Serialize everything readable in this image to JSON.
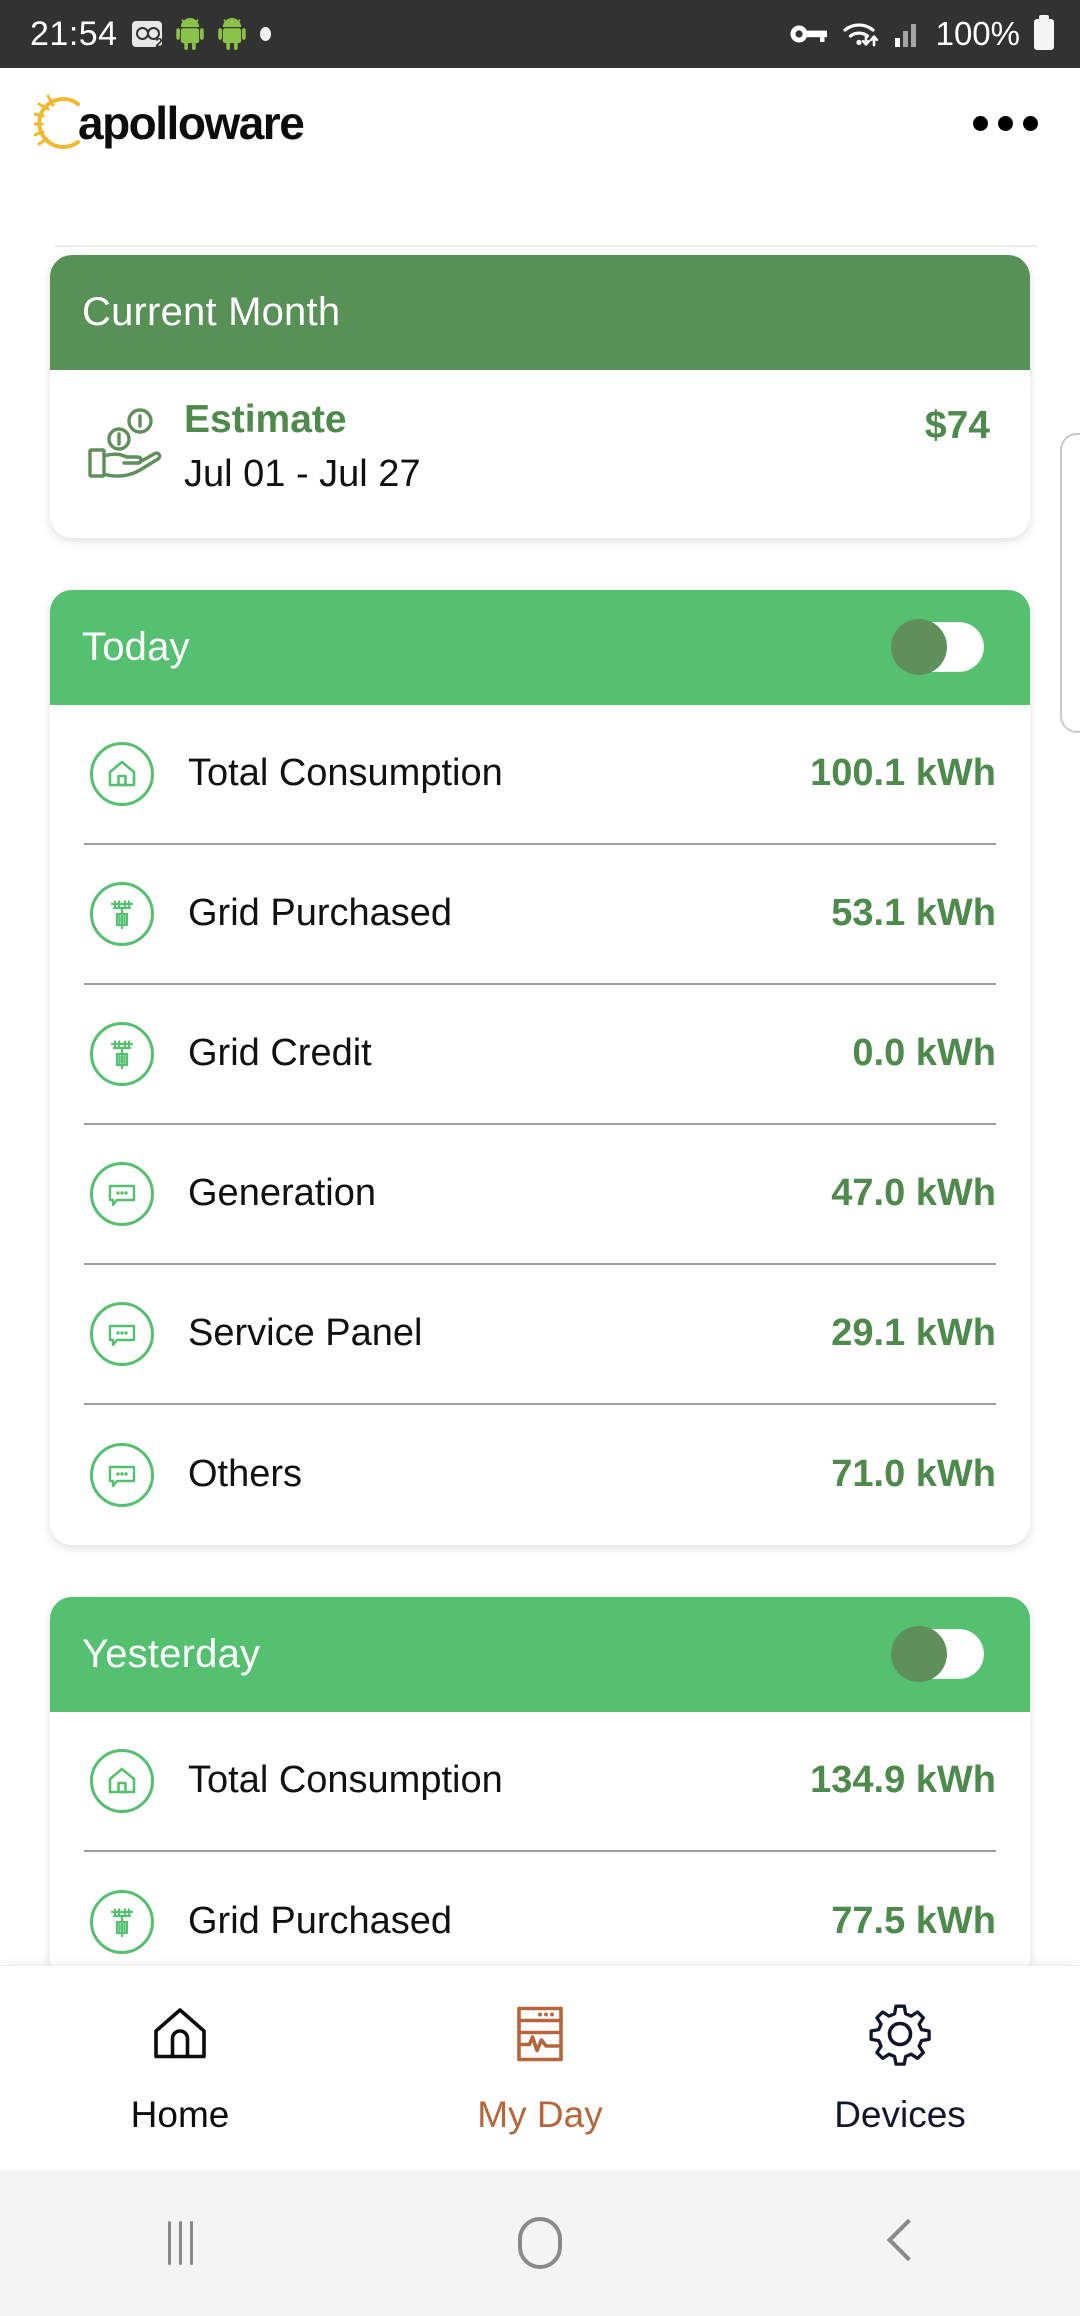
{
  "status_bar": {
    "time": "21:54",
    "voicemail_badge": "2",
    "battery_percent": "100%",
    "icons": [
      "voicemail-icon",
      "android-robot-icon",
      "android-robot-icon",
      "dot-icon",
      "vpn-key-icon",
      "wifi-icon",
      "cellular-signal-icon",
      "battery-icon"
    ]
  },
  "header": {
    "logo_text": "apolloware",
    "overflow_label": "overflow-menu"
  },
  "current_month": {
    "title": "Current Month",
    "estimate_label": "Estimate",
    "date_range": "Jul 01 - Jul 27",
    "amount": "$74",
    "icon": "hand-coins-icon"
  },
  "today": {
    "title": "Today",
    "toggle_on": false,
    "rows": [
      {
        "icon": "home-icon",
        "label": "Total Consumption",
        "value": "100.1 kWh"
      },
      {
        "icon": "utility-pole-icon",
        "label": "Grid Purchased",
        "value": "53.1 kWh"
      },
      {
        "icon": "utility-pole-icon",
        "label": "Grid Credit",
        "value": "0.0 kWh"
      },
      {
        "icon": "speech-bubble-icon",
        "label": "Generation",
        "value": "47.0 kWh"
      },
      {
        "icon": "speech-bubble-icon",
        "label": "Service Panel",
        "value": "29.1 kWh"
      },
      {
        "icon": "speech-bubble-icon",
        "label": "Others",
        "value": "71.0 kWh"
      }
    ]
  },
  "yesterday": {
    "title": "Yesterday",
    "toggle_on": false,
    "rows": [
      {
        "icon": "home-icon",
        "label": "Total Consumption",
        "value": "134.9 kWh"
      },
      {
        "icon": "utility-pole-icon",
        "label": "Grid Purchased",
        "value": "77.5 kWh"
      }
    ]
  },
  "bottom_nav": {
    "items": [
      {
        "icon": "home-icon",
        "label": "Home",
        "active": false
      },
      {
        "icon": "monitor-chart-icon",
        "label": "My Day",
        "active": true
      },
      {
        "icon": "gear-icon",
        "label": "Devices",
        "active": false
      }
    ]
  },
  "system_nav": {
    "recents": "recent-apps-button",
    "home": "home-button",
    "back": "back-button"
  },
  "colors": {
    "header_dark_green": "#589156",
    "header_light_green": "#55c070",
    "value_green": "#4d8a4b",
    "accent_orange": "#b6663a",
    "status_bar_bg": "#323232"
  }
}
